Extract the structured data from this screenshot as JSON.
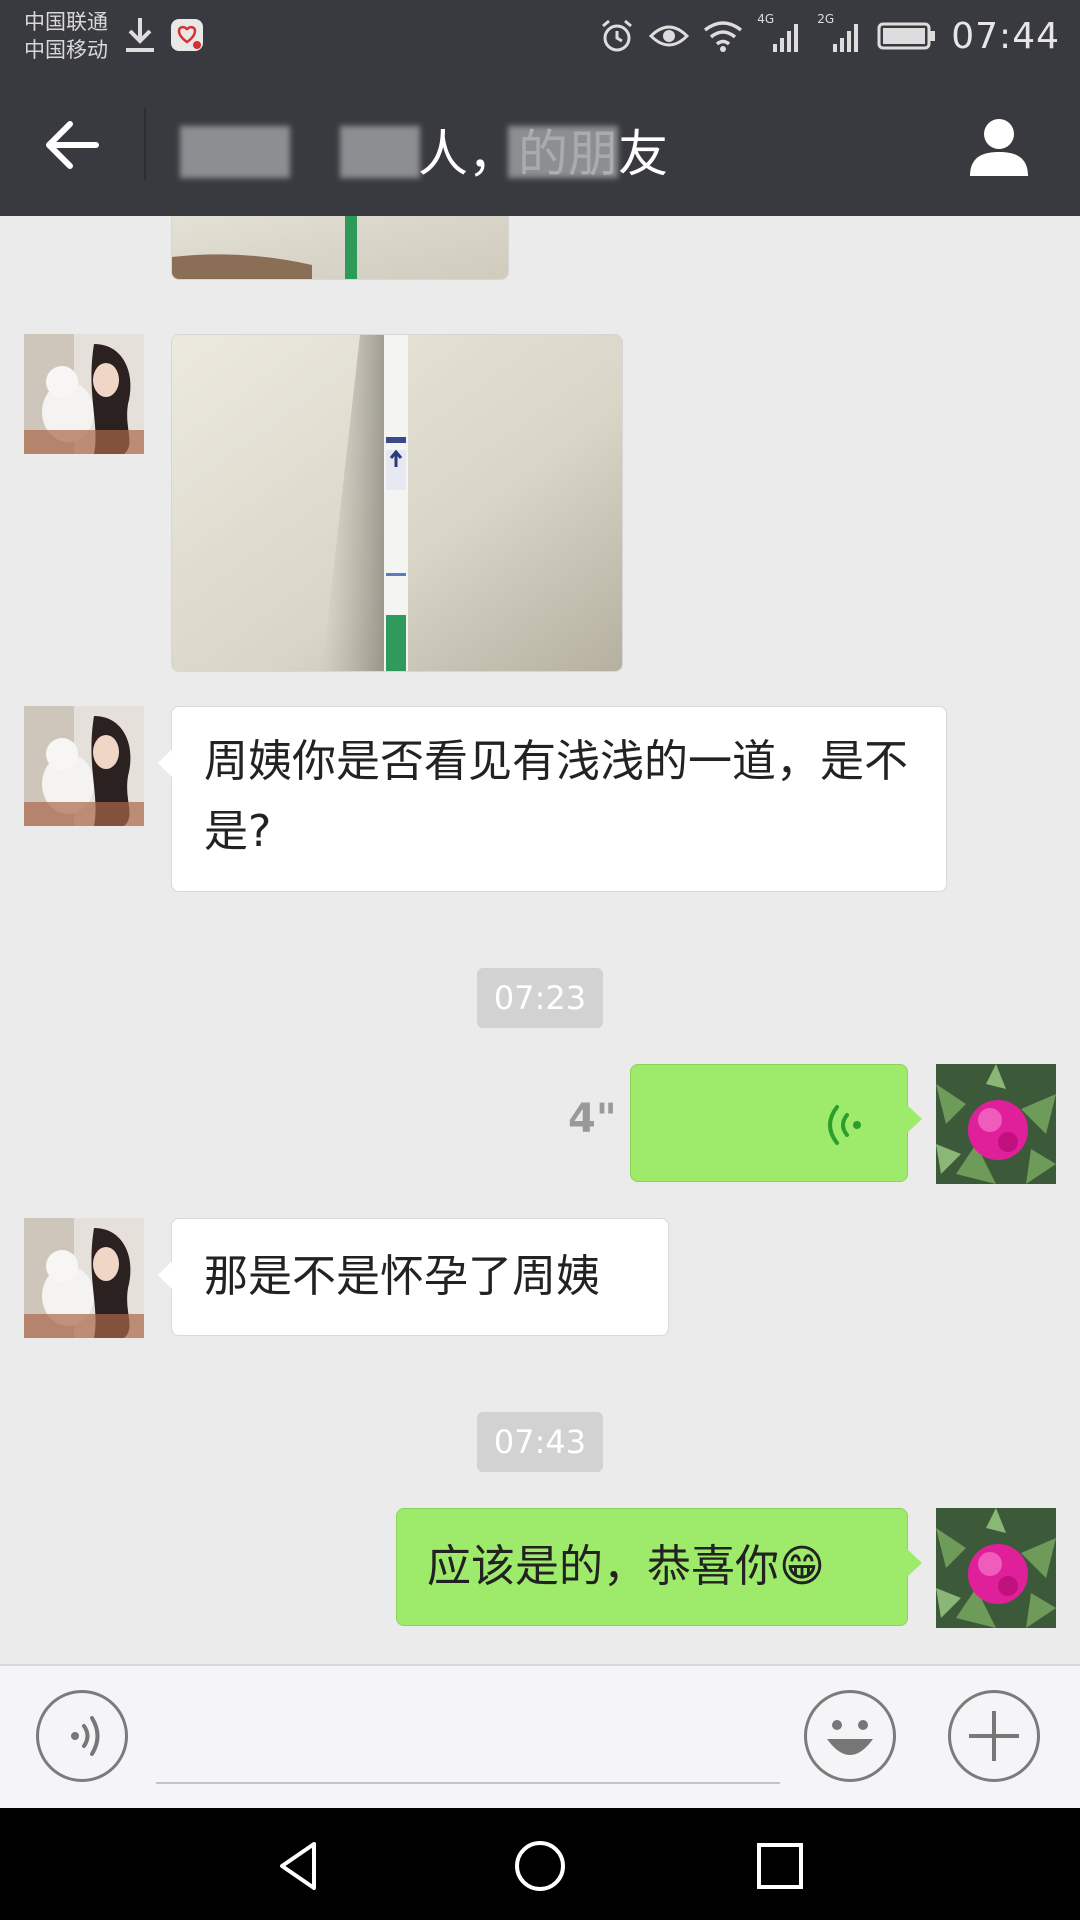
{
  "status_bar": {
    "carrier_1": "中国联通",
    "carrier_2": "中国移动",
    "net_1": "4G",
    "net_2": "2G",
    "time": "07:44"
  },
  "header": {
    "title": "人，的朋友"
  },
  "messages": {
    "text_1": "周姨你是否看见有浅浅的一道，是不是?",
    "timestamp_1": "07:23",
    "voice_duration": "4\"",
    "text_2": "那是不是怀孕了周姨",
    "timestamp_2": "07:43",
    "text_3": "应该是的，恭喜你😁"
  },
  "icons": [
    "back-arrow-icon",
    "profile-icon",
    "alarm-icon",
    "eye-icon",
    "wifi-icon",
    "signal-icon",
    "battery-icon",
    "voice-input-icon",
    "emoji-icon",
    "plus-icon",
    "nav-back-icon",
    "nav-home-icon",
    "nav-recents-icon"
  ],
  "colors": {
    "header_bg": "#393a3f",
    "chat_bg": "#ebebeb",
    "sent_bubble": "#9eea6a",
    "received_bubble": "#ffffff"
  }
}
